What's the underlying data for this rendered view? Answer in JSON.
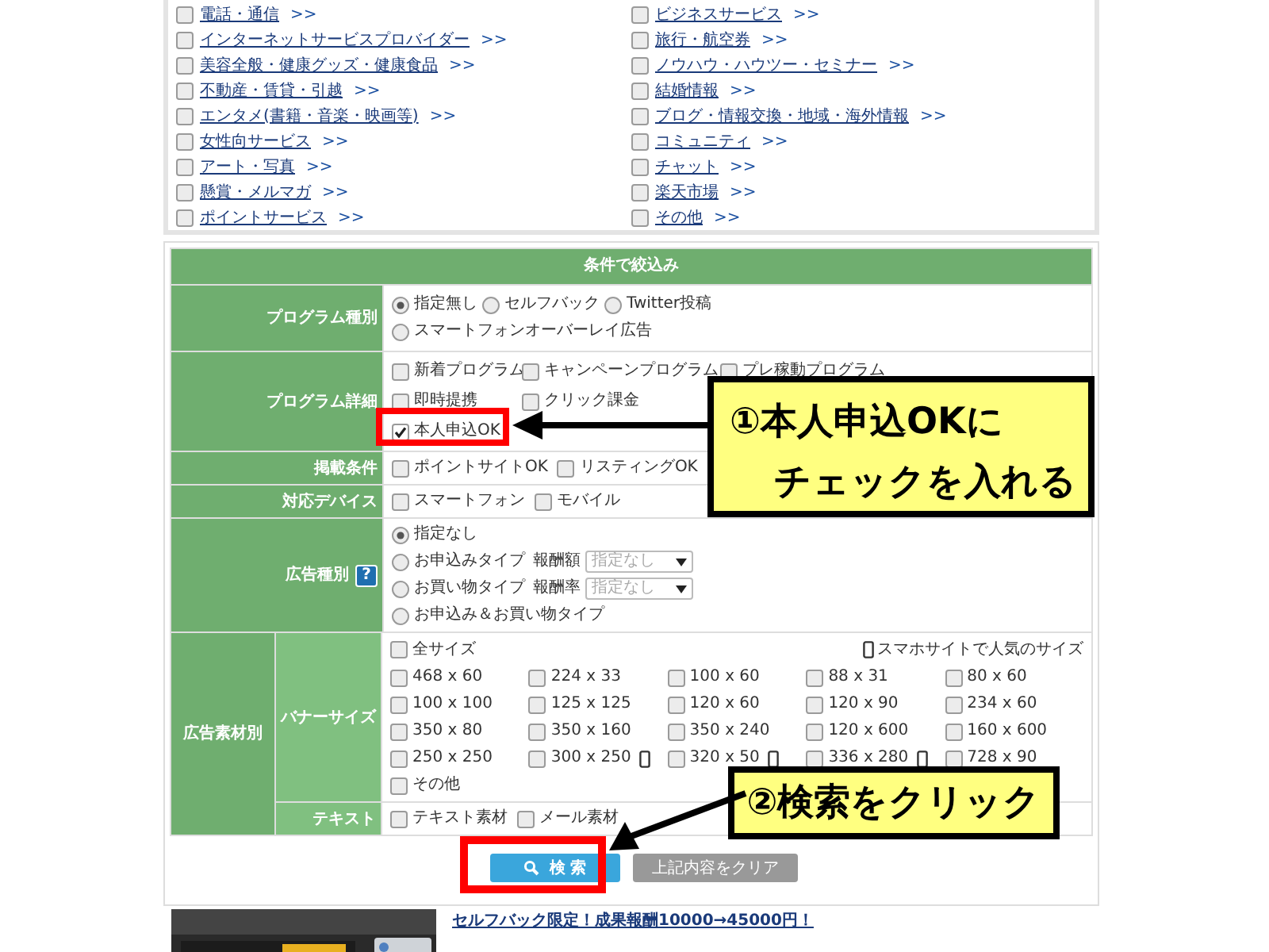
{
  "category_columns": [
    [
      {
        "label": "電話・通信",
        "checked": false
      },
      {
        "label": "インターネットサービスプロバイダー",
        "checked": false
      },
      {
        "label": "美容全般・健康グッズ・健康食品",
        "checked": false
      },
      {
        "label": "不動産・賃貸・引越",
        "checked": false
      },
      {
        "label": "エンタメ(書籍・音楽・映画等)",
        "checked": false
      },
      {
        "label": "女性向サービス",
        "checked": false
      },
      {
        "label": "アート・写真",
        "checked": false
      },
      {
        "label": "懸賞・メルマガ",
        "checked": false
      },
      {
        "label": "ポイントサービス",
        "checked": false
      }
    ],
    [
      {
        "label": "ビジネスサービス",
        "checked": false
      },
      {
        "label": "旅行・航空券",
        "checked": false
      },
      {
        "label": "ノウハウ・ハウツー・セミナー",
        "checked": false
      },
      {
        "label": "結婚情報",
        "checked": false
      },
      {
        "label": "ブログ・情報交換・地域・海外情報",
        "checked": false
      },
      {
        "label": "コミュニティ",
        "checked": false
      },
      {
        "label": "チャット",
        "checked": false
      },
      {
        "label": "楽天市場",
        "checked": false
      },
      {
        "label": "その他",
        "checked": false
      }
    ]
  ],
  "more_mark": ">>",
  "filter": {
    "title": "条件で絞込み",
    "program_type": {
      "label": "プログラム種別",
      "lines": [
        [
          {
            "label": "指定無し",
            "selected": true
          },
          {
            "label": "セルフバック",
            "selected": false
          },
          {
            "label": "Twitter投稿",
            "selected": false
          }
        ],
        [
          {
            "label": "スマートフォンオーバーレイ広告",
            "selected": false
          }
        ]
      ]
    },
    "program_detail": {
      "label": "プログラム詳細",
      "lines": [
        [
          {
            "label": "新着プログラム",
            "checked": false
          },
          {
            "label": "キャンペーンプログラム",
            "checked": false
          },
          {
            "label": "プレ稼動プログラム",
            "checked": false
          }
        ],
        [
          {
            "label": "即時提携",
            "checked": false
          },
          {
            "label": "クリック課金",
            "checked": false
          }
        ],
        [
          {
            "label": "本人申込OK",
            "checked": true
          }
        ]
      ]
    },
    "listing": {
      "label": "掲載条件",
      "options": [
        {
          "label": "ポイントサイトOK",
          "checked": false
        },
        {
          "label": "リスティングOK",
          "checked": false
        }
      ]
    },
    "device": {
      "label": "対応デバイス",
      "options": [
        {
          "label": "スマートフォン",
          "checked": false
        },
        {
          "label": "モバイル",
          "checked": false
        }
      ]
    },
    "ad_type": {
      "label": "広告種別",
      "help": "?",
      "options": [
        {
          "label": "指定なし",
          "selected": true
        },
        {
          "label": "お申込みタイプ",
          "select_label": "報酬額",
          "select_value": "指定なし",
          "selected": false
        },
        {
          "label": "お買い物タイプ",
          "select_label": "報酬率",
          "select_value": "指定なし",
          "selected": false
        },
        {
          "label": "お申込み＆お買い物タイプ",
          "selected": false
        }
      ]
    },
    "ad_material": {
      "label": "広告素材別",
      "banner": {
        "label": "バナーサイズ",
        "all": {
          "label": "全サイズ",
          "checked": false
        },
        "popular_note": "スマホサイトで人気のサイズ",
        "sizes": [
          {
            "label": "468 x 60",
            "checked": false,
            "smartphone": false
          },
          {
            "label": "224 x 33",
            "checked": false,
            "smartphone": false
          },
          {
            "label": "100 x 60",
            "checked": false,
            "smartphone": false
          },
          {
            "label": "88 x 31",
            "checked": false,
            "smartphone": false
          },
          {
            "label": "80 x 60",
            "checked": false,
            "smartphone": false
          },
          {
            "label": "100 x 100",
            "checked": false,
            "smartphone": false
          },
          {
            "label": "125 x 125",
            "checked": false,
            "smartphone": false
          },
          {
            "label": "120 x 60",
            "checked": false,
            "smartphone": false
          },
          {
            "label": "120 x 90",
            "checked": false,
            "smartphone": false
          },
          {
            "label": "234 x 60",
            "checked": false,
            "smartphone": false
          },
          {
            "label": "350 x 80",
            "checked": false,
            "smartphone": false
          },
          {
            "label": "350 x 160",
            "checked": false,
            "smartphone": false
          },
          {
            "label": "350 x 240",
            "checked": false,
            "smartphone": false
          },
          {
            "label": "120 x 600",
            "checked": false,
            "smartphone": false
          },
          {
            "label": "160 x 600",
            "checked": false,
            "smartphone": false
          },
          {
            "label": "250 x 250",
            "checked": false,
            "smartphone": false
          },
          {
            "label": "300 x 250",
            "checked": false,
            "smartphone": true
          },
          {
            "label": "320 x 50",
            "checked": false,
            "smartphone": true
          },
          {
            "label": "336 x 280",
            "checked": false,
            "smartphone": true
          },
          {
            "label": "728 x 90",
            "checked": false,
            "smartphone": false
          },
          {
            "label": "その他",
            "checked": false,
            "smartphone": false
          }
        ]
      },
      "text": {
        "label": "テキスト",
        "options": [
          {
            "label": "テキスト素材",
            "checked": false
          },
          {
            "label": "メール素材",
            "checked": false
          }
        ]
      }
    },
    "buttons": {
      "search": "検 索",
      "clear": "上記内容をクリア"
    }
  },
  "promo": {
    "link": "セルフバック限定！成果報酬10000→45000円！"
  },
  "callouts": [
    {
      "lines": [
        "①本人申込OKに",
        "チェックを入れる"
      ]
    },
    {
      "lines": [
        "②検索をクリック"
      ]
    }
  ]
}
